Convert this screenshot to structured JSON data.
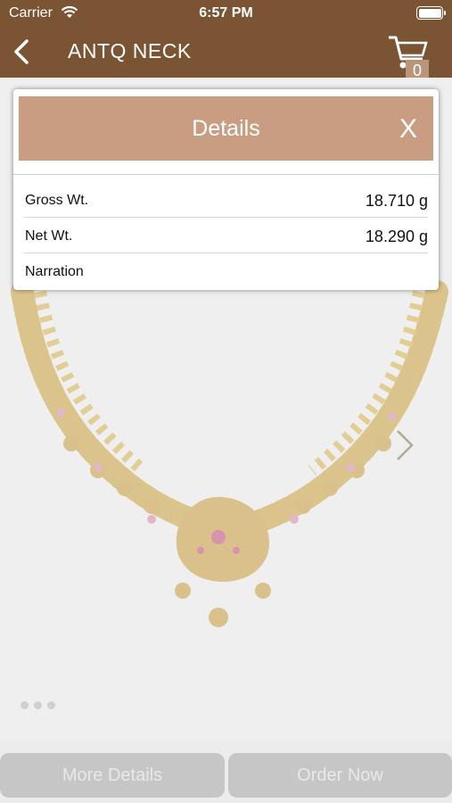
{
  "status_bar": {
    "carrier": "Carrier",
    "time": "6:57 PM"
  },
  "nav": {
    "title": "ANTQ NECK",
    "cart_count": "0"
  },
  "details_dialog": {
    "title": "Details",
    "close_label": "X",
    "rows": [
      {
        "label": "Gross Wt.",
        "value": "18.710 g"
      },
      {
        "label": "Net Wt.",
        "value": "18.290 g"
      },
      {
        "label": "Narration",
        "value": ""
      }
    ]
  },
  "buttons": {
    "more_details": "More Details",
    "order_now": "Order Now"
  },
  "colors": {
    "brand_brown": "#7b5433",
    "dialog_header": "#c99d82",
    "badge": "#b9967a"
  },
  "icons": [
    "back-chevron-icon",
    "cart-icon",
    "next-chevron-icon",
    "wifi-icon",
    "battery-icon"
  ]
}
